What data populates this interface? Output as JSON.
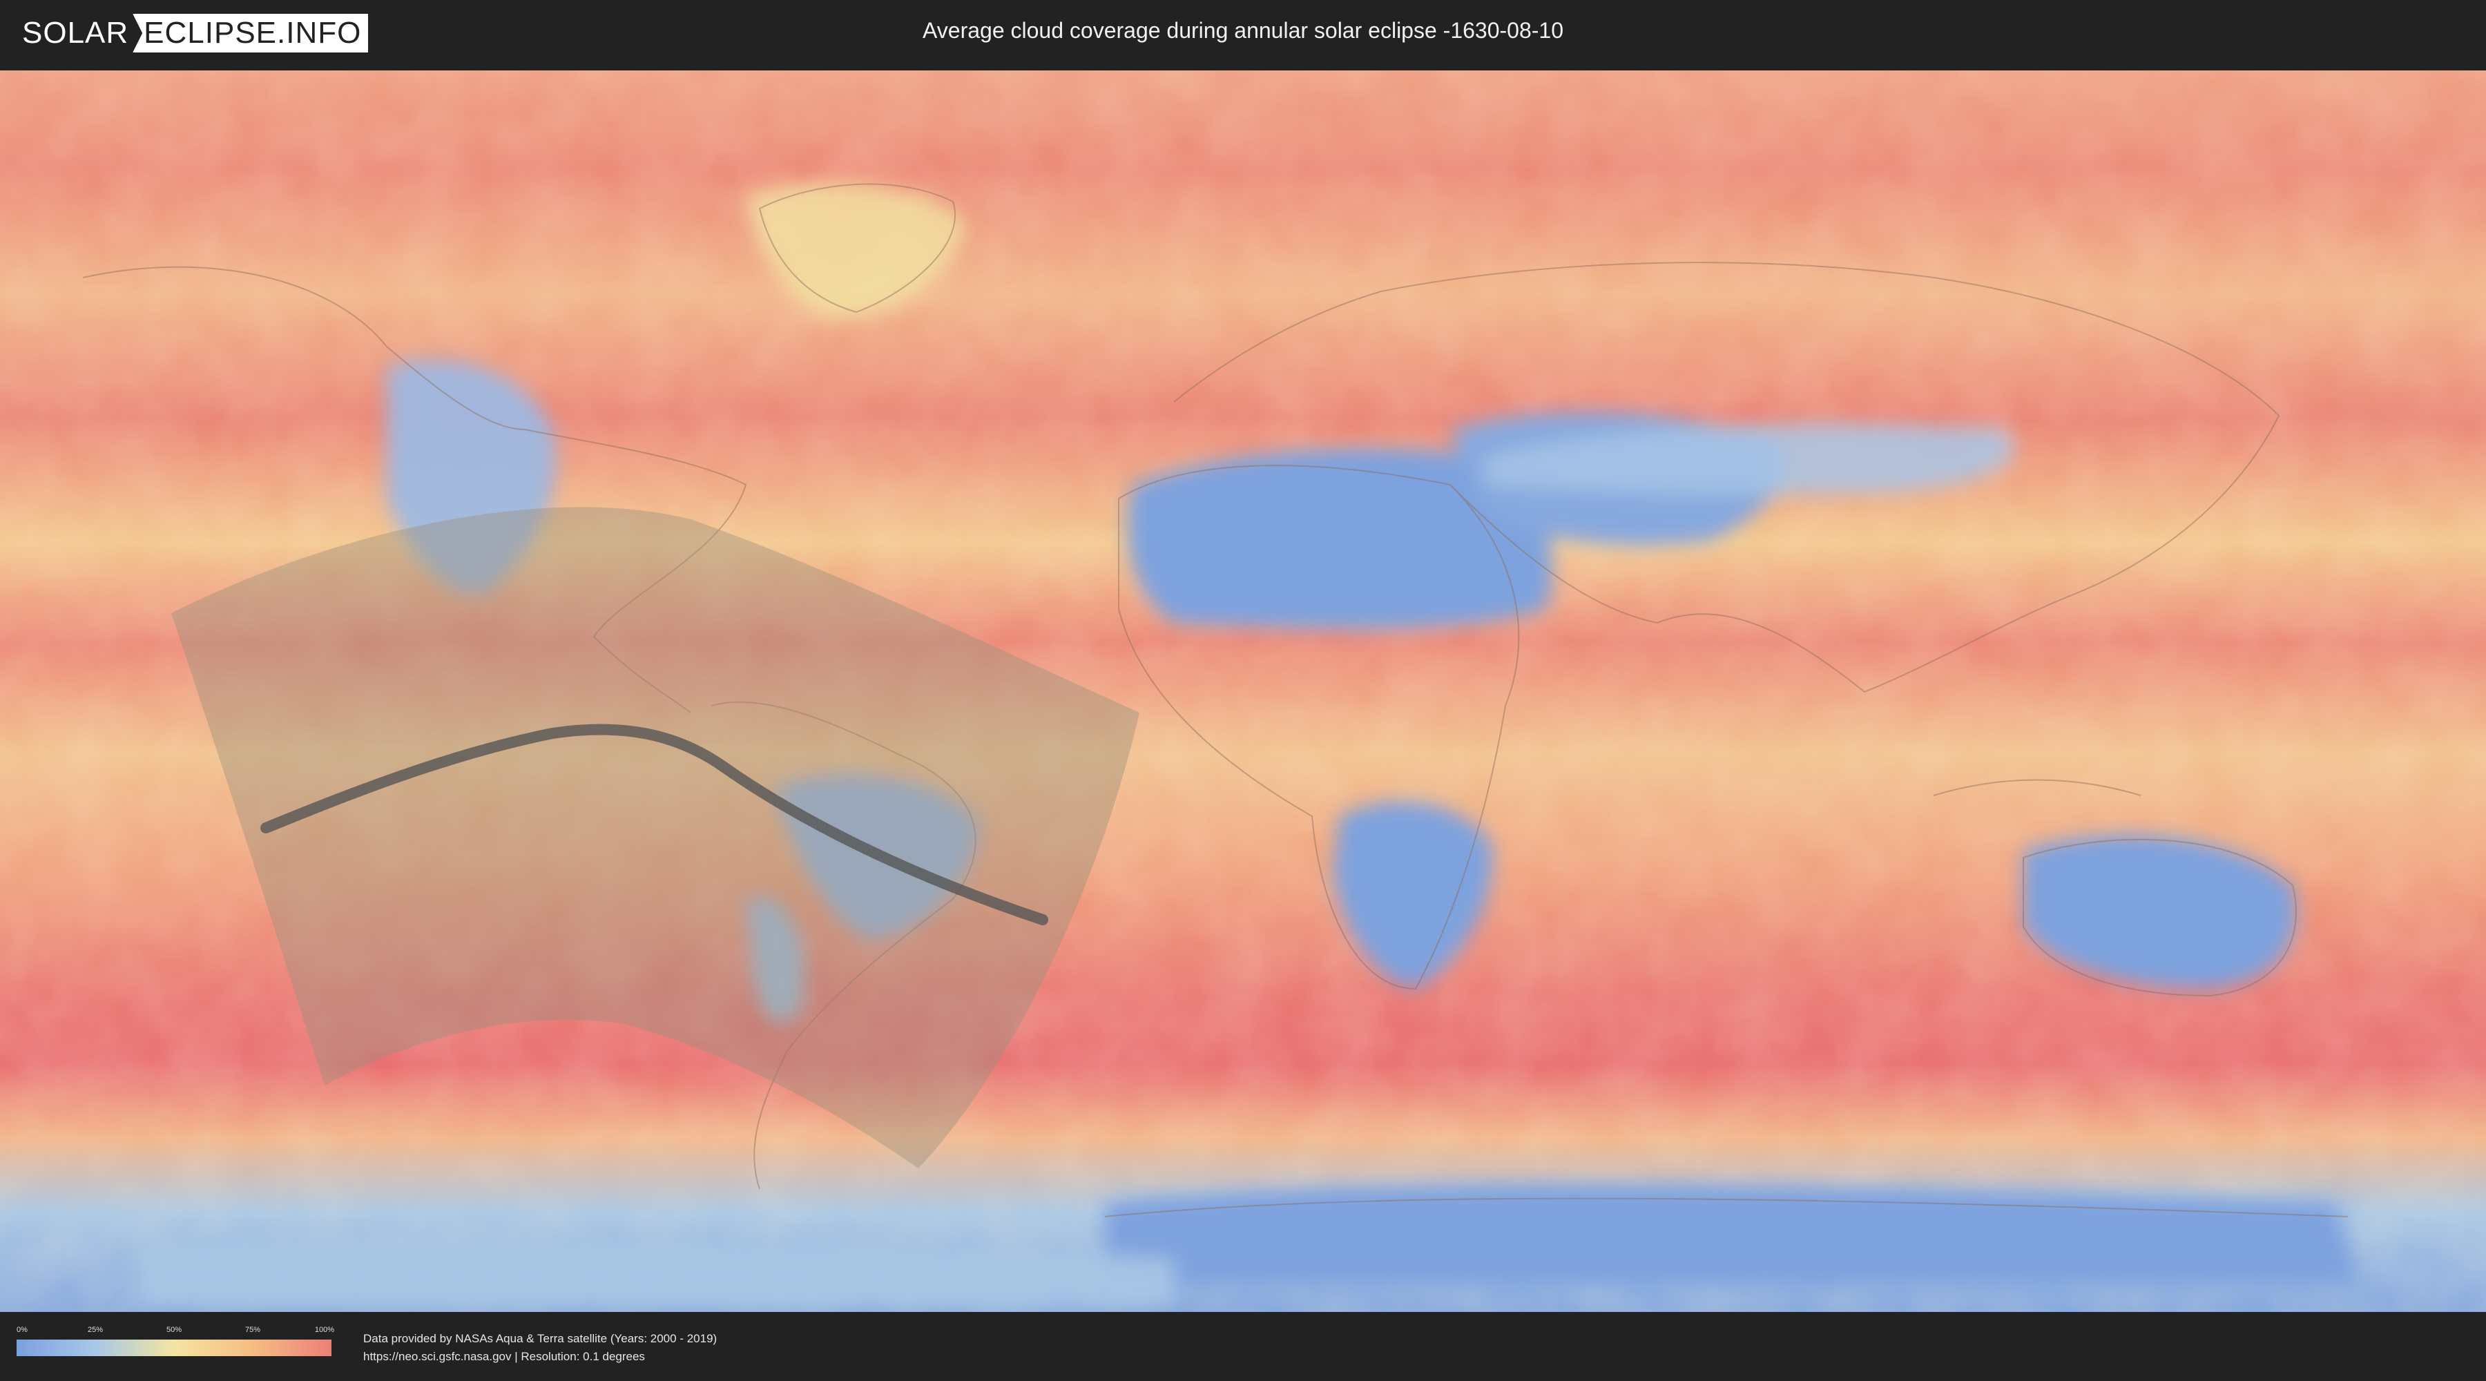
{
  "header": {
    "logo_left": "SOLAR",
    "logo_right": "ECLIPSE.INFO",
    "title": "Average cloud coverage during annular solar eclipse -1630-08-10"
  },
  "legend": {
    "ticks": [
      "0%",
      "25%",
      "50%",
      "75%",
      "100%"
    ],
    "colors": [
      "#7aa0e0",
      "#a8c8e6",
      "#f3e4a3",
      "#f5bd82",
      "#ec7f78"
    ]
  },
  "footer": {
    "credit_line1": "Data provided by NASAs Aqua & Terra satellite (Years: 2000 - 2019)",
    "credit_line2": "https://neo.sci.gsfc.nasa.gov | Resolution: 0.1 degrees"
  },
  "map": {
    "eclipse_type": "annular",
    "date": "-1630-08-10",
    "colors": {
      "clear": "#7ea2de",
      "partly": "#f3e2a5",
      "cloudy": "#ec8076",
      "path_band": "#9a8f7d",
      "central_line": "#555555"
    }
  }
}
